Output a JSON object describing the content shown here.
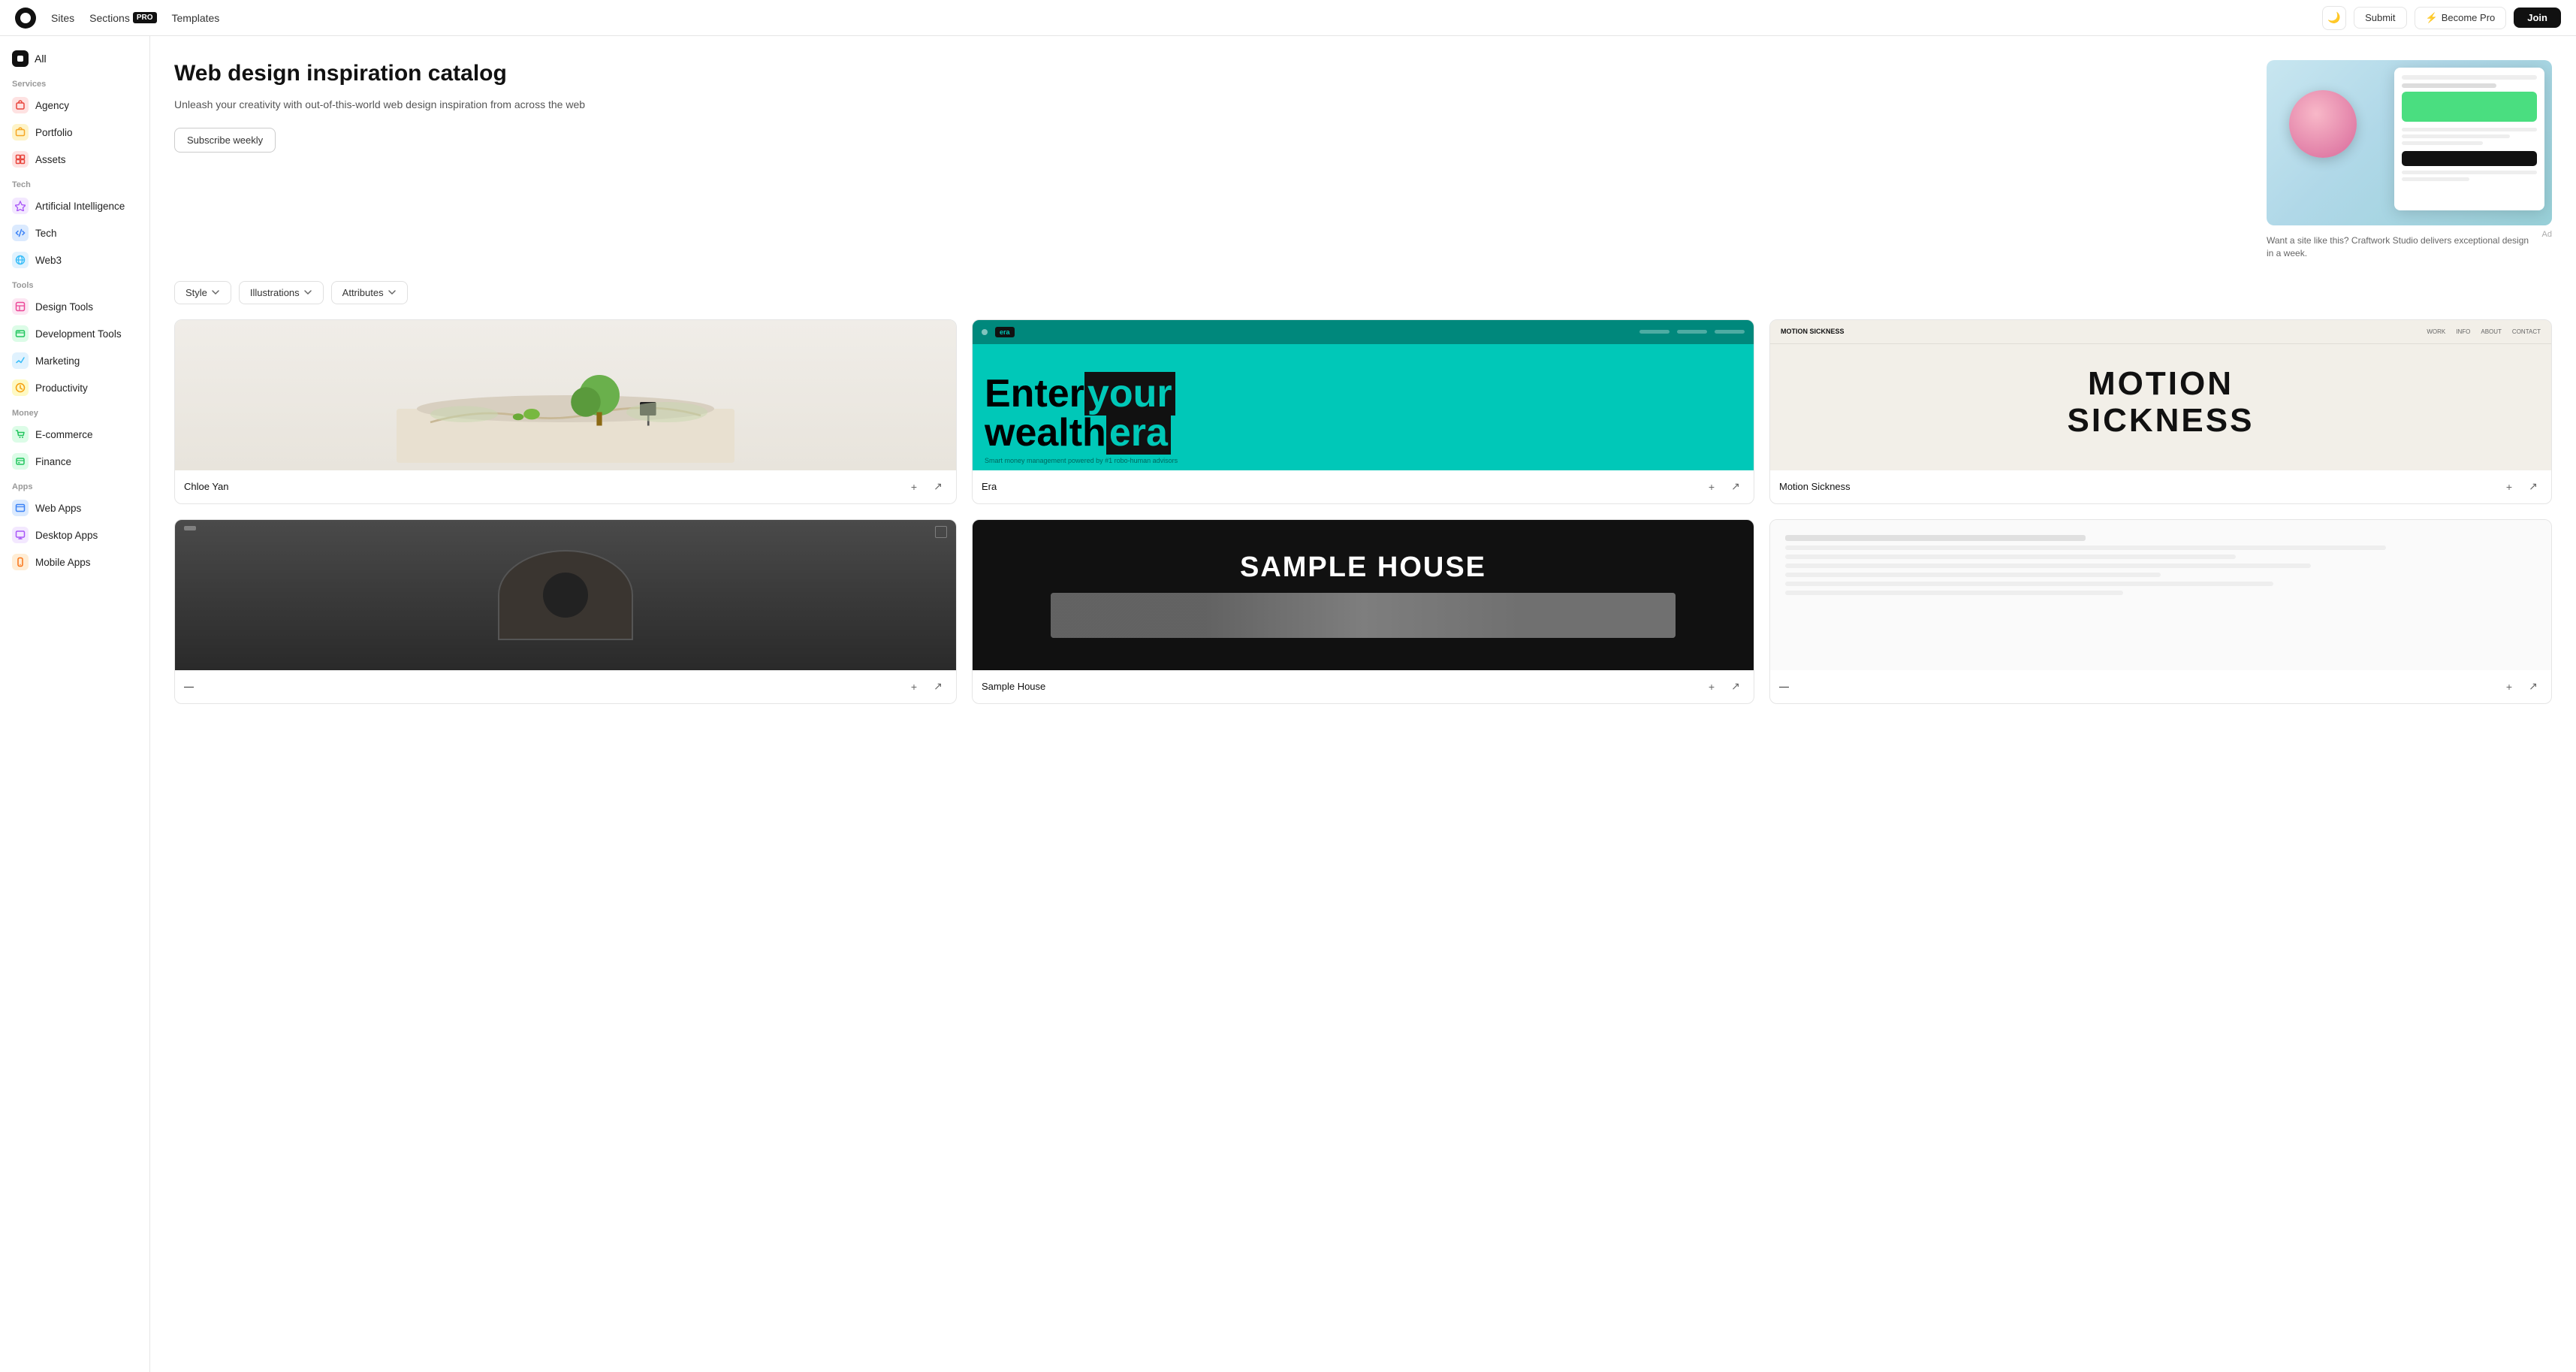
{
  "topnav": {
    "sites_label": "Sites",
    "sections_label": "Sections",
    "pro_label": "PRO",
    "templates_label": "Templates",
    "theme_icon": "🌙",
    "submit_label": "Submit",
    "become_pro_icon": "⚡",
    "become_pro_label": "Become Pro",
    "join_label": "Join"
  },
  "sidebar": {
    "all_label": "All",
    "services_label": "Services",
    "items_services": [
      {
        "name": "Agency",
        "color": "#e8453c",
        "icon": "🔴"
      },
      {
        "name": "Portfolio",
        "color": "#f5a623",
        "icon": "🟠"
      },
      {
        "name": "Assets",
        "color": "#e8453c",
        "icon": "🔴"
      }
    ],
    "tech_label": "Tech",
    "items_tech": [
      {
        "name": "Artificial Intelligence",
        "color": "#a855f7",
        "icon": "🟣"
      },
      {
        "name": "Tech",
        "color": "#3b82f6",
        "icon": "🔵"
      },
      {
        "name": "Web3",
        "color": "#38bdf8",
        "icon": "🩵"
      }
    ],
    "tools_label": "Tools",
    "items_tools": [
      {
        "name": "Design Tools",
        "color": "#ec4899",
        "icon": "🩷"
      },
      {
        "name": "Development Tools",
        "color": "#22c55e",
        "icon": "🟢"
      },
      {
        "name": "Marketing",
        "color": "#38bdf8",
        "icon": "🩵"
      },
      {
        "name": "Productivity",
        "color": "#f59e0b",
        "icon": "🟡"
      }
    ],
    "money_label": "Money",
    "items_money": [
      {
        "name": "E-commerce",
        "color": "#22c55e",
        "icon": "🟢"
      },
      {
        "name": "Finance",
        "color": "#22c55e",
        "icon": "🟢"
      }
    ],
    "apps_label": "Apps",
    "items_apps": [
      {
        "name": "Web Apps",
        "color": "#3b82f6",
        "icon": "🔵"
      },
      {
        "name": "Desktop Apps",
        "color": "#a855f7",
        "icon": "🟣"
      },
      {
        "name": "Mobile Apps",
        "color": "#f97316",
        "icon": "🟠"
      }
    ]
  },
  "hero": {
    "title": "Web design inspiration catalog",
    "subtitle": "Unleash your creativity with out-of-this-world web design inspiration from across the web",
    "subscribe_label": "Subscribe weekly",
    "ad_caption": "Want a site like this? Craftwork Studio delivers exceptional design in a week.",
    "ad_label": "Ad"
  },
  "filters": {
    "style_label": "Style",
    "illustrations_label": "Illustrations",
    "attributes_label": "Attributes"
  },
  "cards": [
    {
      "name": "Chloe Yan",
      "type": "landscape"
    },
    {
      "name": "Era",
      "type": "era"
    },
    {
      "name": "Motion Sickness",
      "type": "motion"
    }
  ]
}
